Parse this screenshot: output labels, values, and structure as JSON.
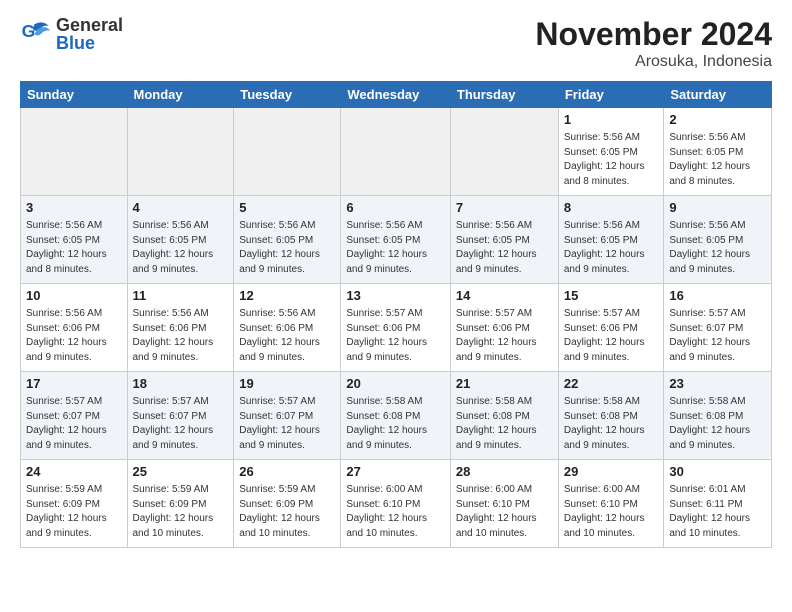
{
  "logo": {
    "general": "General",
    "blue": "Blue"
  },
  "title": "November 2024",
  "subtitle": "Arosuka, Indonesia",
  "days_of_week": [
    "Sunday",
    "Monday",
    "Tuesday",
    "Wednesday",
    "Thursday",
    "Friday",
    "Saturday"
  ],
  "weeks": [
    [
      {
        "day": "",
        "info": "",
        "empty": true
      },
      {
        "day": "",
        "info": "",
        "empty": true
      },
      {
        "day": "",
        "info": "",
        "empty": true
      },
      {
        "day": "",
        "info": "",
        "empty": true
      },
      {
        "day": "",
        "info": "",
        "empty": true
      },
      {
        "day": "1",
        "info": "Sunrise: 5:56 AM\nSunset: 6:05 PM\nDaylight: 12 hours and 8 minutes."
      },
      {
        "day": "2",
        "info": "Sunrise: 5:56 AM\nSunset: 6:05 PM\nDaylight: 12 hours and 8 minutes."
      }
    ],
    [
      {
        "day": "3",
        "info": "Sunrise: 5:56 AM\nSunset: 6:05 PM\nDaylight: 12 hours and 8 minutes."
      },
      {
        "day": "4",
        "info": "Sunrise: 5:56 AM\nSunset: 6:05 PM\nDaylight: 12 hours and 9 minutes."
      },
      {
        "day": "5",
        "info": "Sunrise: 5:56 AM\nSunset: 6:05 PM\nDaylight: 12 hours and 9 minutes."
      },
      {
        "day": "6",
        "info": "Sunrise: 5:56 AM\nSunset: 6:05 PM\nDaylight: 12 hours and 9 minutes."
      },
      {
        "day": "7",
        "info": "Sunrise: 5:56 AM\nSunset: 6:05 PM\nDaylight: 12 hours and 9 minutes."
      },
      {
        "day": "8",
        "info": "Sunrise: 5:56 AM\nSunset: 6:05 PM\nDaylight: 12 hours and 9 minutes."
      },
      {
        "day": "9",
        "info": "Sunrise: 5:56 AM\nSunset: 6:05 PM\nDaylight: 12 hours and 9 minutes."
      }
    ],
    [
      {
        "day": "10",
        "info": "Sunrise: 5:56 AM\nSunset: 6:06 PM\nDaylight: 12 hours and 9 minutes."
      },
      {
        "day": "11",
        "info": "Sunrise: 5:56 AM\nSunset: 6:06 PM\nDaylight: 12 hours and 9 minutes."
      },
      {
        "day": "12",
        "info": "Sunrise: 5:56 AM\nSunset: 6:06 PM\nDaylight: 12 hours and 9 minutes."
      },
      {
        "day": "13",
        "info": "Sunrise: 5:57 AM\nSunset: 6:06 PM\nDaylight: 12 hours and 9 minutes."
      },
      {
        "day": "14",
        "info": "Sunrise: 5:57 AM\nSunset: 6:06 PM\nDaylight: 12 hours and 9 minutes."
      },
      {
        "day": "15",
        "info": "Sunrise: 5:57 AM\nSunset: 6:06 PM\nDaylight: 12 hours and 9 minutes."
      },
      {
        "day": "16",
        "info": "Sunrise: 5:57 AM\nSunset: 6:07 PM\nDaylight: 12 hours and 9 minutes."
      }
    ],
    [
      {
        "day": "17",
        "info": "Sunrise: 5:57 AM\nSunset: 6:07 PM\nDaylight: 12 hours and 9 minutes."
      },
      {
        "day": "18",
        "info": "Sunrise: 5:57 AM\nSunset: 6:07 PM\nDaylight: 12 hours and 9 minutes."
      },
      {
        "day": "19",
        "info": "Sunrise: 5:57 AM\nSunset: 6:07 PM\nDaylight: 12 hours and 9 minutes."
      },
      {
        "day": "20",
        "info": "Sunrise: 5:58 AM\nSunset: 6:08 PM\nDaylight: 12 hours and 9 minutes."
      },
      {
        "day": "21",
        "info": "Sunrise: 5:58 AM\nSunset: 6:08 PM\nDaylight: 12 hours and 9 minutes."
      },
      {
        "day": "22",
        "info": "Sunrise: 5:58 AM\nSunset: 6:08 PM\nDaylight: 12 hours and 9 minutes."
      },
      {
        "day": "23",
        "info": "Sunrise: 5:58 AM\nSunset: 6:08 PM\nDaylight: 12 hours and 9 minutes."
      }
    ],
    [
      {
        "day": "24",
        "info": "Sunrise: 5:59 AM\nSunset: 6:09 PM\nDaylight: 12 hours and 9 minutes."
      },
      {
        "day": "25",
        "info": "Sunrise: 5:59 AM\nSunset: 6:09 PM\nDaylight: 12 hours and 10 minutes."
      },
      {
        "day": "26",
        "info": "Sunrise: 5:59 AM\nSunset: 6:09 PM\nDaylight: 12 hours and 10 minutes."
      },
      {
        "day": "27",
        "info": "Sunrise: 6:00 AM\nSunset: 6:10 PM\nDaylight: 12 hours and 10 minutes."
      },
      {
        "day": "28",
        "info": "Sunrise: 6:00 AM\nSunset: 6:10 PM\nDaylight: 12 hours and 10 minutes."
      },
      {
        "day": "29",
        "info": "Sunrise: 6:00 AM\nSunset: 6:10 PM\nDaylight: 12 hours and 10 minutes."
      },
      {
        "day": "30",
        "info": "Sunrise: 6:01 AM\nSunset: 6:11 PM\nDaylight: 12 hours and 10 minutes."
      }
    ]
  ]
}
